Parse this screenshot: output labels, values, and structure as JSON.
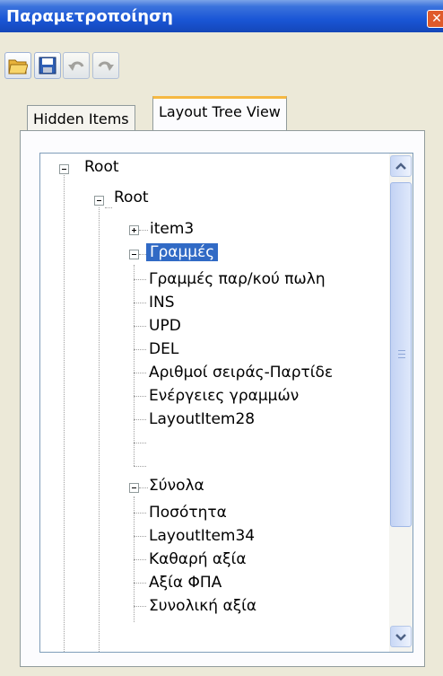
{
  "window": {
    "title": "Παραμετροποίηση",
    "close_glyph": "✕"
  },
  "toolbar": {
    "buttons": [
      "open-folder-icon",
      "save-icon",
      "undo-icon",
      "redo-icon"
    ]
  },
  "tabs": [
    {
      "label": "Hidden Items",
      "active": false
    },
    {
      "label": "Layout Tree View",
      "active": true
    }
  ],
  "tree": {
    "root": "Root",
    "child_root": "Root",
    "item3": "item3",
    "lines": {
      "label": "Γραμμές",
      "children": [
        "Γραμμές παρ/κού πωλη",
        "INS",
        "UPD",
        "DEL",
        "Αριθμοί σειράς-Παρτίδε",
        "Ενέργειες γραμμών",
        "LayoutItem28"
      ]
    },
    "totals": {
      "label": "Σύνολα",
      "children": [
        "Ποσότητα",
        "LayoutItem34",
        "Καθαρή αξία",
        "Αξία ΦΠΑ",
        "Συνολική αξία"
      ]
    }
  },
  "colors": {
    "selection": "#316ac5",
    "title_bar": "#1a56d6"
  }
}
